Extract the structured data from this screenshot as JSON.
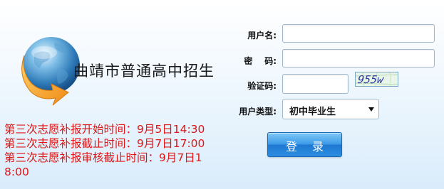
{
  "site": {
    "title": "曲靖市普通高中招生",
    "globe_icon": "globe-with-arrow-icon"
  },
  "notices": [
    "第三次志愿补报开始时间：9月5日14:30",
    "第三次志愿补报截止时间：9月7日17:00",
    "第三次志愿补报审核截止时间：9月7日18:00"
  ],
  "login": {
    "username_label": "用户名:",
    "username_value": "",
    "password_label": "密    码:",
    "password_value": "",
    "captcha_label": "验证码:",
    "captcha_value": "",
    "captcha_image_text": "955w",
    "user_type_label": "用户类型:",
    "user_type_selected": "初中毕业生",
    "submit_label": "登 录"
  },
  "colors": {
    "notice_red": "#e01515",
    "button_blue": "#2c8ee0",
    "background_blue": "#d9ecfb"
  }
}
